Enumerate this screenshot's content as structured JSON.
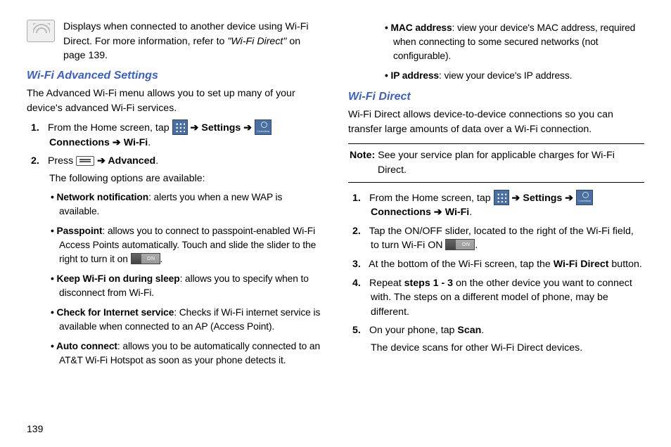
{
  "pageNumber": "139",
  "left": {
    "topBlock": {
      "text_a": "Displays when connected to another device using Wi-Fi Direct. For more information, refer to ",
      "ref": "\"Wi-Fi Direct\"",
      "text_b": "  on page 139."
    },
    "heading": "Wi-Fi Advanced Settings",
    "intro": "The Advanced Wi-Fi menu allows you to set up many of your device's advanced Wi-Fi services.",
    "step1_a": "From the Home screen, tap ",
    "step1_b": " ➔ ",
    "step1_settings": "Settings",
    "step1_c": " ➔ ",
    "step1_connections": "Connections",
    "step1_d": " ➔ ",
    "step1_wifi": "Wi-Fi",
    "step1_e": ".",
    "step2_a": "Press ",
    "step2_b": " ➔ ",
    "step2_advanced": "Advanced",
    "step2_c": ".",
    "step2_after": "The following options are available:",
    "bullets": {
      "nn_label": "Network notification",
      "nn_text": ": alerts you when a new WAP is available.",
      "pp_label": "Passpoint",
      "pp_text_a": ": allows you to connect to passpoint-enabled Wi-Fi Access Points automatically. Touch and slide the slider to the right to turn it on ",
      "pp_text_b": ".",
      "kw_label": "Keep Wi-Fi on during sleep",
      "kw_text": ": allows you to specify when to disconnect from Wi-Fi.",
      "ci_label": "Check for Internet service",
      "ci_text": ": Checks if Wi-Fi internet service is available when connected to an AP (Access Point).",
      "ac_label": "Auto connect",
      "ac_text": ": allows you to be automatically connected to an AT&T Wi-Fi Hotspot as soon as your phone detects it."
    }
  },
  "right": {
    "bullets": {
      "mac_label": "MAC address",
      "mac_text": ": view your device's MAC address, required when connecting to some secured networks (not configurable).",
      "ip_label": "IP address",
      "ip_text": ": view your device's IP address."
    },
    "heading": "Wi-Fi Direct",
    "intro": "Wi-Fi Direct allows device-to-device connections so you can transfer large amounts of data over a Wi-Fi connection.",
    "note_label": "Note:",
    "note_text": " See your service plan for applicable charges for Wi-Fi Direct.",
    "step1_a": "From the Home screen, tap ",
    "step1_b": " ➔ ",
    "step1_settings": "Settings",
    "step1_c": " ➔ ",
    "step1_connections": "Connections",
    "step1_d": " ➔ ",
    "step1_wifi": "Wi-Fi",
    "step1_e": ".",
    "step2_a": "Tap the ON/OFF slider, located to the right of the Wi-Fi field, to turn Wi-Fi ON ",
    "step2_b": ".",
    "step3_a": "At the bottom of the Wi-Fi screen, tap the ",
    "step3_wfd": "Wi-Fi Direct",
    "step3_b": " button.",
    "step4_a": "Repeat ",
    "step4_bold": "steps 1 - 3",
    "step4_b": " on the other device you want to connect with. The steps on a different model of phone, may be different.",
    "step5_a": "On your phone, tap ",
    "step5_scan": "Scan",
    "step5_b": ".",
    "step5_after": "The device scans for other Wi-Fi Direct devices."
  }
}
